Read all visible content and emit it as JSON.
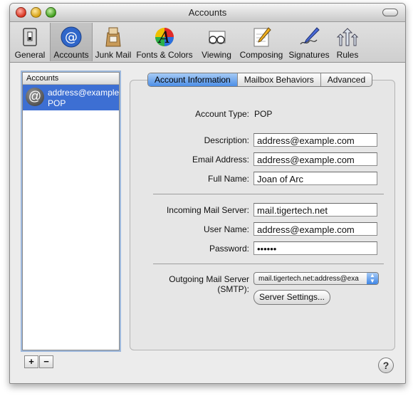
{
  "window": {
    "title": "Accounts"
  },
  "toolbar": {
    "items": [
      {
        "label": "General",
        "icon": "switch-icon"
      },
      {
        "label": "Accounts",
        "icon": "at-sign-icon"
      },
      {
        "label": "Junk Mail",
        "icon": "junk-bag-icon"
      },
      {
        "label": "Fonts & Colors",
        "icon": "font-colors-icon"
      },
      {
        "label": "Viewing",
        "icon": "glasses-icon"
      },
      {
        "label": "Composing",
        "icon": "pencil-paper-icon"
      },
      {
        "label": "Signatures",
        "icon": "pen-signature-icon"
      },
      {
        "label": "Rules",
        "icon": "rules-arrows-icon"
      }
    ],
    "selected": "Accounts"
  },
  "accounts_list": {
    "header": "Accounts",
    "items": [
      {
        "name": "address@example",
        "type": "POP"
      }
    ],
    "add_label": "+",
    "remove_label": "−"
  },
  "tabs": [
    {
      "label": "Account Information",
      "active": true
    },
    {
      "label": "Mailbox Behaviors",
      "active": false
    },
    {
      "label": "Advanced",
      "active": false
    }
  ],
  "form": {
    "account_type_label": "Account Type:",
    "account_type_value": "POP",
    "description_label": "Description:",
    "description_value": "address@example.com",
    "email_label": "Email Address:",
    "email_value": "address@example.com",
    "fullname_label": "Full Name:",
    "fullname_value": "Joan of Arc",
    "incoming_label": "Incoming Mail Server:",
    "incoming_value": "mail.tigertech.net",
    "username_label": "User Name:",
    "username_value": "address@example.com",
    "password_label": "Password:",
    "password_value": "••••••",
    "smtp_label": "Outgoing Mail Server (SMTP):",
    "smtp_value": "mail.tigertech.net:address@exa",
    "server_settings_label": "Server Settings..."
  },
  "help_label": "?",
  "colors": {
    "selection": "#3d6fd3",
    "accent": "#4d8ee6"
  }
}
